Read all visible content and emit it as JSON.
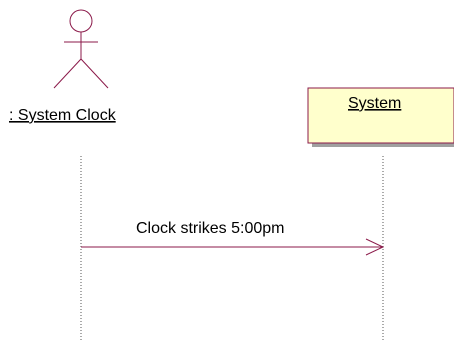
{
  "actor": {
    "name": ": System Clock"
  },
  "object": {
    "name": "System"
  },
  "message": {
    "label": "Clock strikes 5:00pm"
  },
  "colors": {
    "actor_stroke": "#8b1a4a",
    "object_fill": "#ffffcc",
    "object_stroke": "#8b1a4a",
    "message_line": "#8b1a4a",
    "lifeline": "#555555"
  }
}
